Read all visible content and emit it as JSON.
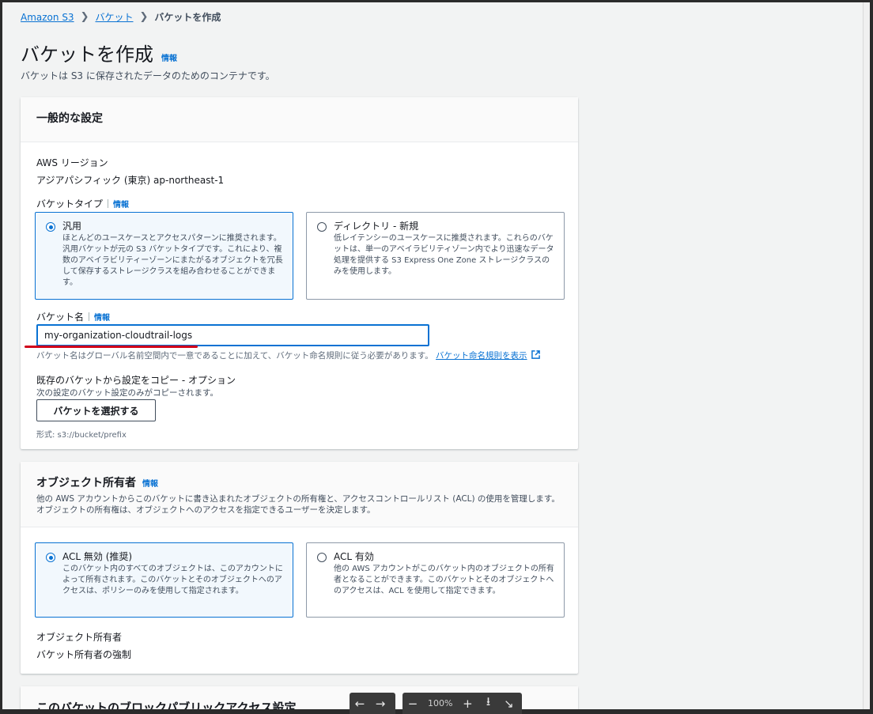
{
  "breadcrumb": {
    "root": "Amazon S3",
    "parent": "バケット",
    "current": "バケットを作成"
  },
  "page": {
    "title": "バケットを作成",
    "info": "情報",
    "description": "バケットは S3 に保存されたデータのためのコンテナです。"
  },
  "general": {
    "title": "一般的な設定",
    "region_label": "AWS リージョン",
    "region_value": "アジアパシフィック (東京) ap-northeast-1",
    "bucket_type_label": "バケットタイプ",
    "info": "情報",
    "type_general": {
      "title": "汎用",
      "desc": "ほとんどのユースケースとアクセスパターンに推奨されます。汎用バケットが元の S3 バケットタイプです。これにより、複数のアベイラビリティーゾーンにまたがるオブジェクトを冗長して保存するストレージクラスを組み合わせることができます。"
    },
    "type_directory": {
      "title": "ディレクトリ - 新規",
      "desc": "低レイテンシーのユースケースに推奨されます。これらのバケットは、単一のアベイラビリティゾーン内でより迅速なデータ処理を提供する S3 Express One Zone ストレージクラスのみを使用します。"
    },
    "bucket_name_label": "バケット名",
    "bucket_name_value": "my-organization-cloudtrail-logs",
    "bucket_name_hint": "バケット名はグローバル名前空間内で一意であることに加えて、バケット命名規則に従う必要があります。",
    "naming_rules_link": "バケット命名規則を表示",
    "copy_label": "既存のバケットから設定をコピー - オプション",
    "copy_hint": "次の設定のバケット設定のみがコピーされます。",
    "choose_bucket_button": "バケットを選択する",
    "format_hint": "形式: s3://bucket/prefix"
  },
  "ownership": {
    "title": "オブジェクト所有者",
    "info": "情報",
    "desc": "他の AWS アカウントからこのバケットに書き込まれたオブジェクトの所有権と、アクセスコントロールリスト (ACL) の使用を管理します。オブジェクトの所有権は、オブジェクトへのアクセスを指定できるユーザーを決定します。",
    "acl_disabled": {
      "title": "ACL 無効 (推奨)",
      "desc": "このバケット内のすべてのオブジェクトは、このアカウントによって所有されます。このバケットとそのオブジェクトへのアクセスは、ポリシーのみを使用して指定されます。"
    },
    "acl_enabled": {
      "title": "ACL 有効",
      "desc": "他の AWS アカウントがこのバケット内のオブジェクトの所有者となることができます。このバケットとそのオブジェクトへのアクセスは、ACL を使用して指定できます。"
    },
    "owner_label": "オブジェクト所有者",
    "owner_value": "バケット所有者の強制"
  },
  "block_public": {
    "title": "このバケットのブロックパブリックアクセス設定"
  },
  "viewer": {
    "zoom": "100%"
  },
  "colors": {
    "accent": "#0972d3",
    "annotation": "#d0021b"
  }
}
